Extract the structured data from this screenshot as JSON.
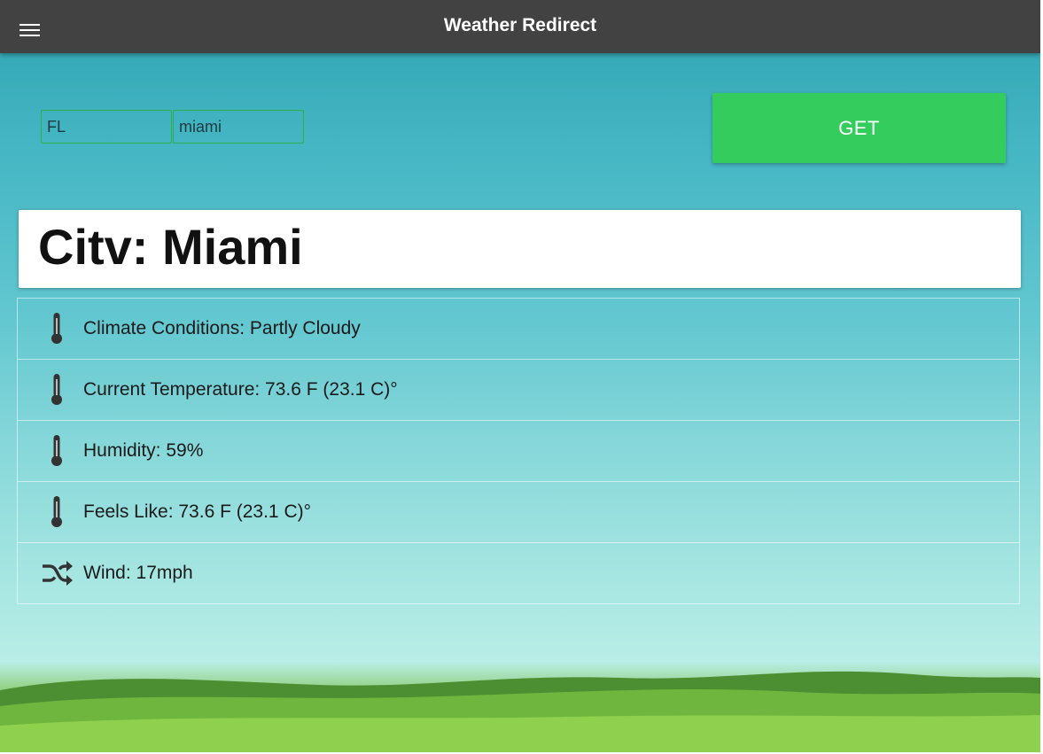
{
  "header": {
    "title": "Weather Redirect",
    "menu_icon": "hamburger-menu-icon"
  },
  "search": {
    "state_value": "FL",
    "city_value": "miami",
    "get_label": "GET"
  },
  "city_card": {
    "title": "Citv: Miami"
  },
  "details": [
    {
      "icon": "thermometer-icon",
      "text": "Climate Conditions: Partly Cloudy"
    },
    {
      "icon": "thermometer-icon",
      "text": "Current Temperature: 73.6 F (23.1 C)°"
    },
    {
      "icon": "thermometer-icon",
      "text": "Humidity: 59%"
    },
    {
      "icon": "thermometer-icon",
      "text": "Feels Like: 73.6 F (23.1 C)°"
    },
    {
      "icon": "shuffle-icon",
      "text": "Wind: 17mph"
    }
  ],
  "colors": {
    "header": "#424242",
    "button": "#34cc5d",
    "input_border": "#2fae4a"
  }
}
